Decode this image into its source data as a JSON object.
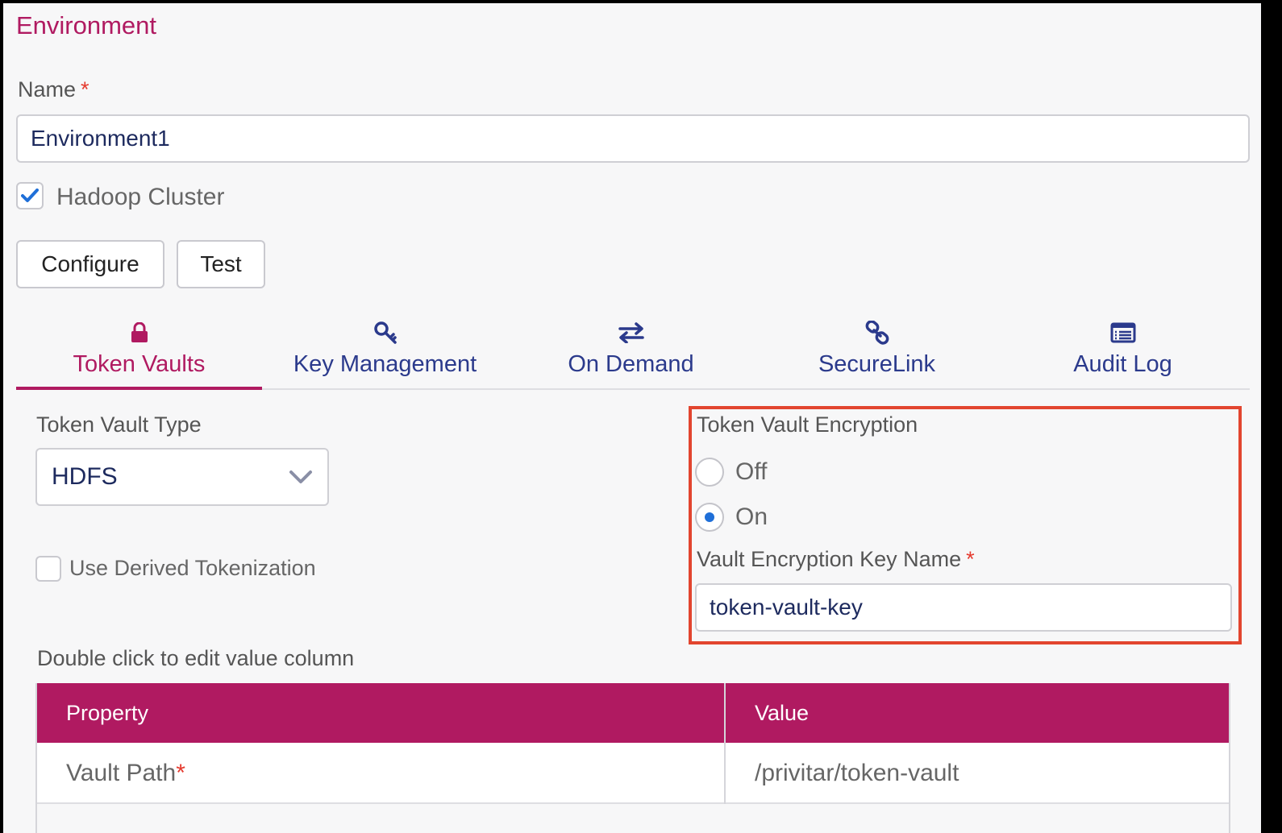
{
  "page": {
    "title": "Environment"
  },
  "name_field": {
    "label": "Name",
    "required": "*",
    "value": "Environment1"
  },
  "hadoop": {
    "label": "Hadoop Cluster",
    "checked": true
  },
  "buttons": {
    "configure": "Configure",
    "test": "Test"
  },
  "tabs": [
    {
      "label": "Token Vaults",
      "icon": "lock-icon",
      "active": true
    },
    {
      "label": "Key Management",
      "icon": "key-icon",
      "active": false
    },
    {
      "label": "On Demand",
      "icon": "arrows-exchange-icon",
      "active": false
    },
    {
      "label": "SecureLink",
      "icon": "link-icon",
      "active": false
    },
    {
      "label": "Audit Log",
      "icon": "list-icon",
      "active": false
    }
  ],
  "vault_type": {
    "label": "Token Vault Type",
    "selected": "HDFS"
  },
  "derived": {
    "label": "Use Derived Tokenization",
    "checked": false
  },
  "encryption": {
    "label": "Token Vault Encryption",
    "options": [
      "Off",
      "On"
    ],
    "selected": "On",
    "key_label": "Vault Encryption Key Name",
    "key_required": "*",
    "key_value": "token-vault-key"
  },
  "table": {
    "hint": "Double click to edit value column",
    "headers": [
      "Property",
      "Value"
    ],
    "rows": [
      {
        "property": "Vault Path",
        "required": "*",
        "value": "/privitar/token-vault"
      }
    ]
  },
  "colors": {
    "accent": "#b01a61",
    "link": "#2b3a8c",
    "highlight": "#e2452f",
    "radio": "#1f6fd8"
  }
}
